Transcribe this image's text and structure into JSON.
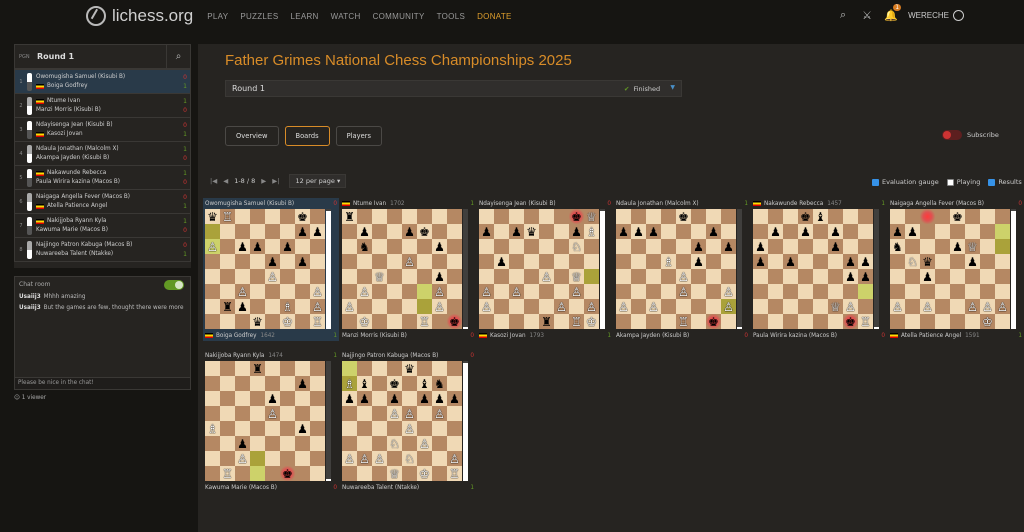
{
  "site": {
    "logo": "lichess.org",
    "nav": [
      "PLAY",
      "PUZZLES",
      "LEARN",
      "WATCH",
      "COMMUNITY",
      "TOOLS",
      "DONATE"
    ],
    "notifications": "1",
    "username": "WERECHE"
  },
  "sidebar": {
    "pgn": "PGN",
    "round": "Round 1",
    "games": [
      {
        "num": "1",
        "white": "Owomugisha Samuel (Kisubi B)",
        "black": "Boiga Godfrey",
        "wres": "0",
        "bres": "1",
        "wflag": false,
        "bflag": true,
        "active": true
      },
      {
        "num": "2",
        "white": "Ntume Ivan",
        "black": "Manzi Morris (Kisubi B)",
        "wres": "1",
        "bres": "0",
        "wflag": true,
        "bflag": false
      },
      {
        "num": "3",
        "white": "Ndayisenga Jean (Kisubi B)",
        "black": "Kasozi Jovan",
        "wres": "0",
        "bres": "1",
        "wflag": false,
        "bflag": true
      },
      {
        "num": "4",
        "white": "Ndaula Jonathan (Malcolm X)",
        "black": "Akampa Jayden (Kisubi B)",
        "wres": "1",
        "bres": "0",
        "wflag": false,
        "bflag": false
      },
      {
        "num": "5",
        "white": "Nakawunde Rebecca",
        "black": "Paula Wirira kazina (Macos B)",
        "wres": "1",
        "bres": "0",
        "wflag": true,
        "bflag": false
      },
      {
        "num": "6",
        "white": "Naigaga Angella Fever (Macos B)",
        "black": "Atella Patience Angel",
        "wres": "0",
        "bres": "1",
        "wflag": false,
        "bflag": true
      },
      {
        "num": "7",
        "white": "Nakijjoba Ryann Kyla",
        "black": "Kawuma Marie (Macos B)",
        "wres": "1",
        "bres": "0",
        "wflag": true,
        "bflag": false
      },
      {
        "num": "8",
        "white": "Najjingo Patron Kabuga (Macos B)",
        "black": "Nuwareeba Talent (Ntakke)",
        "wres": "0",
        "bres": "1",
        "wflag": false,
        "bflag": false
      }
    ]
  },
  "chat": {
    "title": "Chat room",
    "messages": [
      {
        "user": "Usaiij3",
        "text": "Mhhh amazing"
      },
      {
        "user": "Usaiij3",
        "text": "But the games are few, thought there were more"
      }
    ],
    "input_placeholder": "Please be nice in the chat!",
    "viewers": "1 viewer"
  },
  "main": {
    "title": "Father Grimes National Chess Championships 2025",
    "round_select": "Round 1",
    "status": "Finished",
    "tabs": [
      "Overview",
      "Boards",
      "Players"
    ],
    "active_tab": "Boards",
    "subscribe": "Subscribe",
    "pager": {
      "range": "1-8 / 8",
      "per_page": "12 per page"
    },
    "options": [
      {
        "label": "Evaluation gauge",
        "checked": true
      },
      {
        "label": "Playing",
        "checked": false
      },
      {
        "label": "Results",
        "checked": true
      }
    ]
  },
  "boards": [
    {
      "top": "Owomugisha Samuel (Kisubi B)",
      "topRating": "",
      "topRes": "0",
      "bottom": "Boiga Godfrey",
      "bottomRating": "1642",
      "bottomRes": "1",
      "bottomFlag": true,
      "topFlag": false,
      "gauge": 0.02,
      "pos": [
        "qR....k.",
        "......pp",
        "P.pp.p..",
        "....p.p.",
        "....P...",
        "..P....P",
        ".rp..B.P",
        "...q.K.R"
      ],
      "hl": [
        "a6",
        "a7"
      ],
      "check": ""
    },
    {
      "top": "Ntume Ivan",
      "topRating": "1702",
      "topRes": "1",
      "bottom": "Manzi Morris (Kisubi B)",
      "bottomRating": "",
      "bottomRes": "0",
      "topFlag": true,
      "bottomFlag": false,
      "gauge": 0.98,
      "pos": [
        "r.......",
        ".p..pk..",
        ".n....p.",
        "....P...",
        "..Q...p.",
        ".P....P.",
        "P.....P.",
        ".K...R.k"
      ],
      "hl": [
        "f3",
        "f2"
      ],
      "check": "h1"
    },
    {
      "top": "Ndayisenga Jean (Kisubi B)",
      "topRating": "",
      "topRes": "0",
      "bottom": "Kasozi Jovan",
      "bottomRating": "1793",
      "bottomRes": "1",
      "topFlag": false,
      "bottomFlag": true,
      "gauge": 0.02,
      "pos": [
        "......kQ",
        "p.pq..pB",
        "......N.",
        ".p......",
        "....P.Q.",
        "P.P...P.",
        "P....P.P",
        "....r.RK"
      ],
      "hl": [
        "h4"
      ],
      "check": "g8"
    },
    {
      "top": "Ndaula Jonathan (Malcolm X)",
      "topRating": "",
      "topRes": "1",
      "bottom": "Akampa Jayden (Kisubi B)",
      "bottomRating": "",
      "bottomRes": "0",
      "topFlag": false,
      "bottomFlag": false,
      "gauge": 0.98,
      "pos": [
        "....k...",
        "ppp...p.",
        ".....p.p",
        "...B.p..",
        "....P...",
        "....P..P",
        "P.P....P",
        "....R.k."
      ],
      "hl": [
        "h2"
      ],
      "check": "g1"
    },
    {
      "top": "Nakawunde Rebecca",
      "topRating": "1457",
      "topRes": "1",
      "bottom": "Paula Wirira kazina (Macos B)",
      "bottomRating": "",
      "bottomRes": "0",
      "topFlag": true,
      "bottomFlag": false,
      "gauge": 0.98,
      "pos": [
        "...kb...",
        ".p.p.p..",
        "p....p..",
        "p.p...pp",
        "......pp",
        "........",
        ".....QP.",
        "......kR"
      ],
      "hl": [
        "h3"
      ],
      "check": "g1"
    },
    {
      "top": "Naigaga Angella Fever (Macos B)",
      "topRating": "",
      "topRes": "0",
      "bottom": "Atella Patience Angel",
      "bottomRating": "1591",
      "bottomRes": "1",
      "topFlag": false,
      "bottomFlag": true,
      "gauge": 0.02,
      "pos": [
        "....k...",
        "pp......",
        "n...pQ..",
        ".Nq..p..",
        "..p.....",
        "........",
        "P.P..PPP",
        "......K."
      ],
      "hl": [
        "h7",
        "h6"
      ],
      "check": "c8"
    },
    {
      "top": "Nakijjoba Ryann Kyla",
      "topRating": "1474",
      "topRes": "1",
      "bottom": "Kawuma Marie (Macos B)",
      "bottomRating": "",
      "bottomRes": "0",
      "topFlag": false,
      "bottomFlag": false,
      "gauge": 0.98,
      "pos": [
        "...r....",
        "......p.",
        "....p...",
        "....P...",
        "B.....p.",
        "..p.....",
        "..P.....",
        ".R...k.."
      ],
      "hl": [
        "d2",
        "d1"
      ],
      "check": "f1"
    },
    {
      "top": "Najjingo Patron Kabuga (Macos B)",
      "topRating": "",
      "topRes": "0",
      "bottom": "Nuwareeba Talent (Ntakke)",
      "bottomRating": "",
      "bottomRes": "1",
      "topFlag": false,
      "bottomFlag": false,
      "gauge": 0.02,
      "pos": [
        "....q...",
        "Bb.k.bn.",
        "pp.p.ppp",
        "...PP.P.",
        "....P...",
        "...N.P..",
        "PPP.N..P",
        "...Q.K.R"
      ],
      "hl": [
        "a8",
        "a7"
      ],
      "check": ""
    }
  ]
}
